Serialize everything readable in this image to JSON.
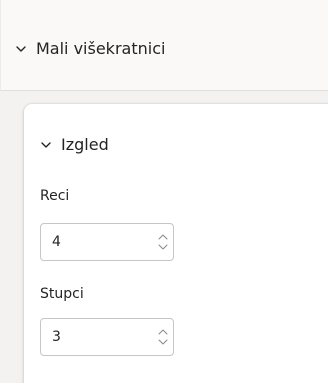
{
  "section": {
    "title": "Mali višekratnici",
    "icon": "chevron-down-icon"
  },
  "card": {
    "title": "Izgled",
    "icon": "chevron-down-icon",
    "fields": [
      {
        "label": "Reci",
        "value": "4"
      },
      {
        "label": "Stupci",
        "value": "3"
      }
    ]
  },
  "colors": {
    "pane_background": "#f3f2f1",
    "header_background": "#faf9f8",
    "card_background": "#ffffff",
    "input_border": "#c8c6c4",
    "text": "#252423"
  }
}
